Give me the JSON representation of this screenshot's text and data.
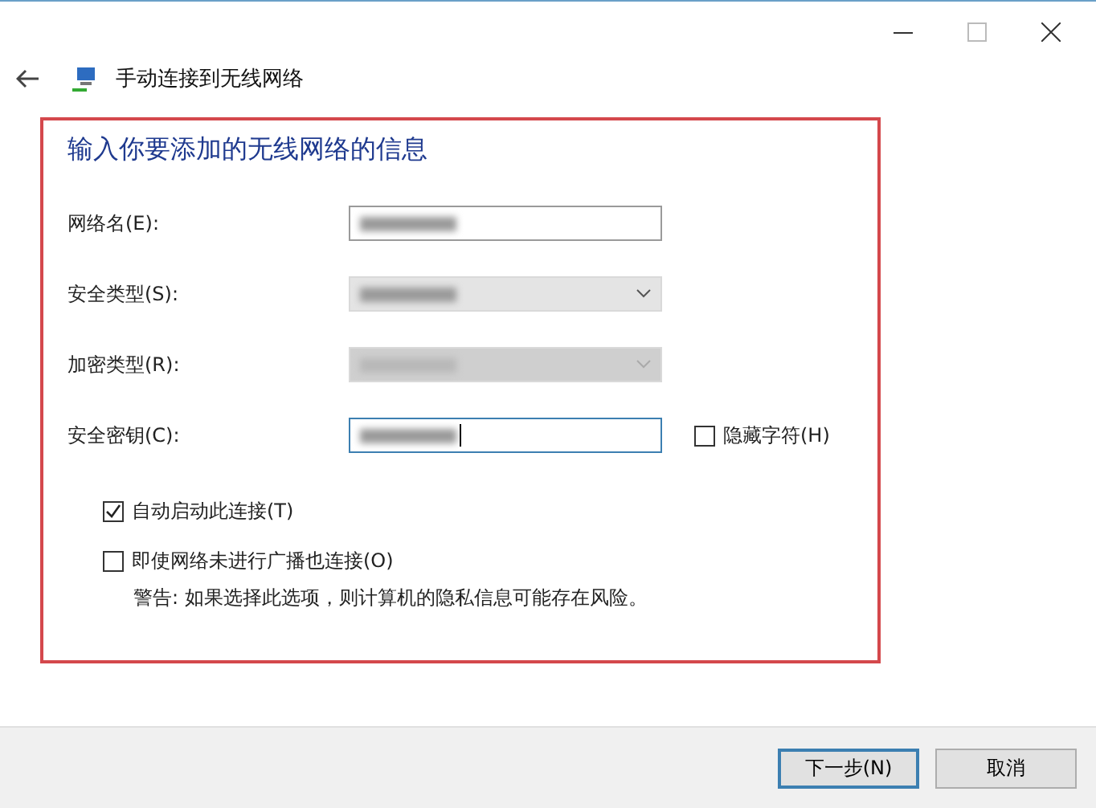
{
  "window": {
    "title": "手动连接到无线网络"
  },
  "heading": "输入你要添加的无线网络的信息",
  "fields": [
    {
      "kind": "text",
      "label": "网络名(E):",
      "redacted": true,
      "disabled": false,
      "focused": false
    },
    {
      "kind": "select",
      "label": "安全类型(S):",
      "redacted": true,
      "disabled": false,
      "focused": false
    },
    {
      "kind": "select",
      "label": "加密类型(R):",
      "redacted": true,
      "disabled": true,
      "focused": false
    },
    {
      "kind": "text",
      "label": "安全密钥(C):",
      "redacted": true,
      "disabled": false,
      "focused": true
    }
  ],
  "hide_characters": {
    "label": "隐藏字符(H)",
    "checked": false
  },
  "options": [
    {
      "label": "自动启动此连接(T)",
      "checked": true
    },
    {
      "label": "即使网络未进行广播也连接(O)",
      "checked": false
    }
  ],
  "warning": "警告: 如果选择此选项，则计算机的隐私信息可能存在风险。",
  "buttons": [
    {
      "label": "下一步(N)",
      "primary": true
    },
    {
      "label": "取消",
      "primary": false
    }
  ]
}
